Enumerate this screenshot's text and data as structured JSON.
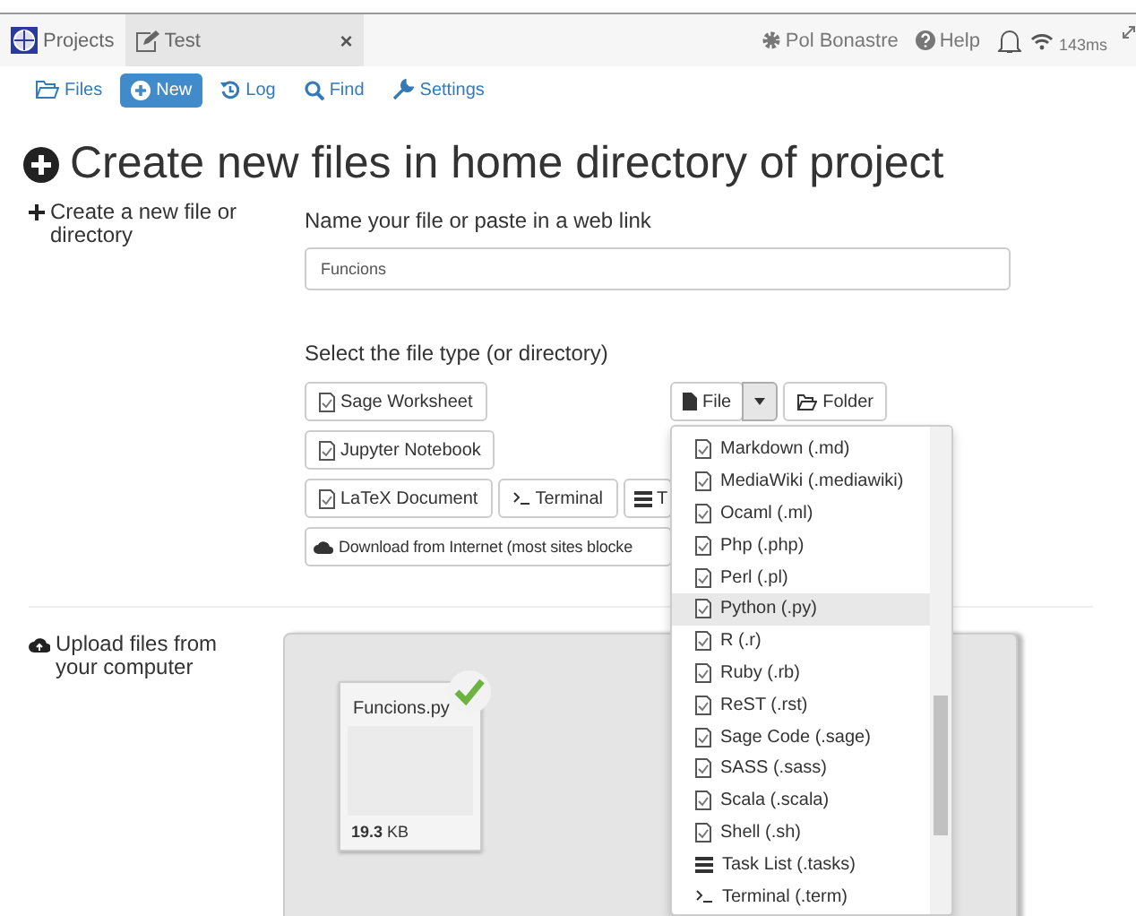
{
  "top_bar": {
    "tabs": [
      {
        "label": "Projects",
        "kind": "logo",
        "selected": false
      },
      {
        "label": "Test",
        "kind": "edit",
        "selected": true
      }
    ],
    "close": "×",
    "user": "Pol Bonastre",
    "help": "Help",
    "ping": "143ms"
  },
  "nav": [
    {
      "label": "Files",
      "kind": "folder",
      "selected": false
    },
    {
      "label": "New",
      "kind": "plus",
      "selected": true
    },
    {
      "label": "Log",
      "kind": "history",
      "selected": false
    },
    {
      "label": "Find",
      "kind": "search",
      "selected": false
    },
    {
      "label": "Settings",
      "kind": "wrench",
      "selected": false
    }
  ],
  "title": "Create new files in home directory of project",
  "create": {
    "label": "Create a new file or directory",
    "name_label": "Name your file or paste in a web link",
    "name_value": "Funcions",
    "type_label": "Select the file type (or directory)",
    "buttons": [
      [
        {
          "label": "Sage Worksheet",
          "kind": "doc"
        }
      ],
      [
        {
          "label": "Jupyter Notebook",
          "kind": "doc"
        }
      ],
      [
        {
          "label": "LaTeX Document",
          "kind": "doc"
        },
        {
          "label": "Terminal",
          "kind": "terminal"
        },
        {
          "label": "T",
          "kind": "list"
        }
      ],
      [
        {
          "label": "Download from Internet (most sites blocke",
          "kind": "cloud"
        }
      ]
    ],
    "file_button": "File",
    "folder_button": "Folder",
    "menu": [
      {
        "label": "Markdown (.md)",
        "kind": "doc",
        "selected": false
      },
      {
        "label": "MediaWiki (.mediawiki)",
        "kind": "doc",
        "selected": false
      },
      {
        "label": "Ocaml (.ml)",
        "kind": "doc",
        "selected": false
      },
      {
        "label": "Php (.php)",
        "kind": "doc",
        "selected": false
      },
      {
        "label": "Perl (.pl)",
        "kind": "doc",
        "selected": false
      },
      {
        "label": "Python (.py)",
        "kind": "doc",
        "selected": true
      },
      {
        "label": "R (.r)",
        "kind": "doc",
        "selected": false
      },
      {
        "label": "Ruby (.rb)",
        "kind": "doc",
        "selected": false
      },
      {
        "label": "ReST (.rst)",
        "kind": "doc",
        "selected": false
      },
      {
        "label": "Sage Code (.sage)",
        "kind": "doc",
        "selected": false
      },
      {
        "label": "SASS (.sass)",
        "kind": "doc",
        "selected": false
      },
      {
        "label": "Scala (.scala)",
        "kind": "doc",
        "selected": false
      },
      {
        "label": "Shell (.sh)",
        "kind": "doc",
        "selected": false
      },
      {
        "label": "Task List (.tasks)",
        "kind": "list",
        "selected": false
      },
      {
        "label": "Terminal (.term)",
        "kind": "terminal",
        "selected": false
      }
    ]
  },
  "upload": {
    "label": "Upload files from your computer",
    "file": {
      "name": "Funcions.py",
      "size": "19.3",
      "unit": "KB",
      "done": true
    }
  }
}
